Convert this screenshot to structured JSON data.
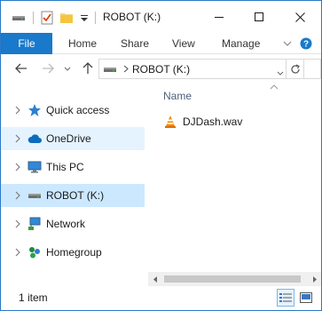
{
  "window": {
    "title": "ROBOT (K:)",
    "accent_color": "#1979ca"
  },
  "quick_access_toolbar": {
    "icons": [
      "drive-icon",
      "properties-icon",
      "new-folder-icon",
      "customize-dropdown-icon"
    ]
  },
  "ribbon": {
    "tabs": [
      "File",
      "Home",
      "Share",
      "View",
      "Manage"
    ]
  },
  "address_bar": {
    "path": "ROBOT (K:)"
  },
  "nav_pane": {
    "items": [
      {
        "label": "Quick access",
        "icon": "star-icon"
      },
      {
        "label": "OneDrive",
        "icon": "cloud-icon"
      },
      {
        "label": "This PC",
        "icon": "computer-icon"
      },
      {
        "label": "ROBOT (K:)",
        "icon": "drive-icon"
      },
      {
        "label": "Network",
        "icon": "network-icon"
      },
      {
        "label": "Homegroup",
        "icon": "homegroup-icon"
      }
    ]
  },
  "content": {
    "column_header": "Name",
    "files": [
      {
        "name": "DJDash.wav",
        "icon": "vlc-cone-icon"
      }
    ]
  },
  "status_bar": {
    "item_count": "1 item"
  }
}
